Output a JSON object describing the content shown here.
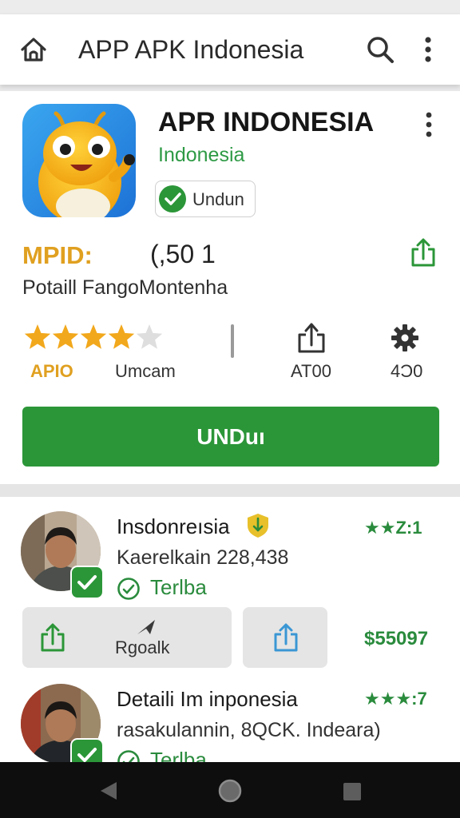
{
  "appbar": {
    "title": "APP APK  Indonesia",
    "icons": [
      "home-icon",
      "search-icon",
      "more-vert-icon"
    ]
  },
  "app": {
    "name": "APR INDONESIA",
    "region": "Indonesia",
    "chip_label": "Undun",
    "mpid_label": "MPID:",
    "mpid_value": "(,50 1",
    "description": "Potaill FangoMontenha",
    "rating_value": 3.5,
    "rating_label": "APIO",
    "rating_sub": "Umcam",
    "share_label": "AT00",
    "settings_label": "4Ɔ0",
    "download_label": "UNDuı"
  },
  "list": [
    {
      "title": "Insdonreısia",
      "subtitle": "Kaerelkain 228,438",
      "tag": "Terlba",
      "rating": "★★Z:1",
      "action_label": "Rgoalk",
      "price": "$55097"
    },
    {
      "title": "Detaili Im inponesia",
      "subtitle": "rasakulannin, 8QCK. Indeara)",
      "tag": "Terlba",
      "rating": "★★★:7"
    }
  ],
  "colors": {
    "accent_green": "#2b9638",
    "gold": "#e0a020",
    "nav_bg": "#0e0e0e"
  }
}
